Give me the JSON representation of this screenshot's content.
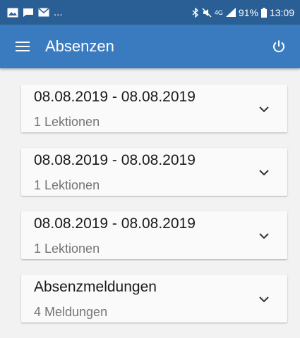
{
  "status_bar": {
    "left_dots": "...",
    "battery": "91%",
    "time": "13:09",
    "network": "4G"
  },
  "app_bar": {
    "title": "Absenzen"
  },
  "cards": [
    {
      "title": "08.08.2019 - 08.08.2019",
      "subtitle": "1 Lektionen"
    },
    {
      "title": "08.08.2019 - 08.08.2019",
      "subtitle": "1 Lektionen"
    },
    {
      "title": "08.08.2019 - 08.08.2019",
      "subtitle": "1 Lektionen"
    },
    {
      "title": "Absenzmeldungen",
      "subtitle": "4 Meldungen"
    }
  ],
  "colors": {
    "status_bar": "#2a5f95",
    "app_bar": "#3a7bbf",
    "background": "#f2f2f2"
  }
}
